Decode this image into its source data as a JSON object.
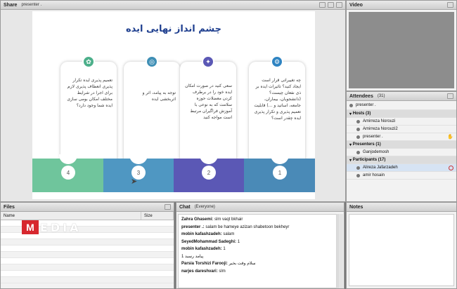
{
  "share": {
    "title": "Share",
    "presenter": "presenter ."
  },
  "slide": {
    "title": "چشم انداز نهایی ایده",
    "cards": [
      {
        "text": "تعمیم پذیری ایده تکرار پذیری انعطاف پذیری لازم برای اجرا در شرایط مختلف امکان بومی سازی ایده شما وجود دارد؟",
        "icon_color": "#4caf8a",
        "icon": "leaf-icon"
      },
      {
        "text": "توجه به پیامد، اثر و اثربخشی ایده",
        "icon_color": "#3f8fb5",
        "icon": "target-icon"
      },
      {
        "text": "سعی کنید در صورت امکان ایده خود را در برطرف کردن معضلات حوزه سلامت که به نوعی با آموزش فراگیران مرتبط است مواجه کنید",
        "icon_color": "#5b58b5",
        "icon": "idea-icon"
      },
      {
        "text": "چه تغییراتی قرار است ایجاد کنید؟ تاثیرات ایده بر ذی نفعان چیست؟ (دانشجویان، بیماران، جامعه، اساتید و ...) قابلیت تعمیم پذیری و تکرار پذیری ایده چقدر است؟",
        "icon_color": "#2f84c2",
        "icon": "gear-icon"
      }
    ],
    "bands": [
      {
        "num": "4",
        "color": "#6fc59c"
      },
      {
        "num": "3",
        "color": "#4f97c2"
      },
      {
        "num": "2",
        "color": "#5b58b5"
      },
      {
        "num": "1",
        "color": "#4a8ab7"
      }
    ]
  },
  "video": {
    "title": "Video"
  },
  "attendees": {
    "title": "Attendees",
    "count": "(31)",
    "me": "presenter .",
    "hosts_label": "Hosts (3)",
    "hosts": [
      "Amirreza Norouzi",
      "Amirreza Norouzi2",
      "presenter ."
    ],
    "presenters_label": "Presenters (1)",
    "presenters": [
      "Ganjodemosh"
    ],
    "participants_label": "Participants (17)",
    "participants": [
      "Alireza Jafarzadeh",
      "amir hosain"
    ]
  },
  "files": {
    "title": "Files",
    "col_name": "Name",
    "col_size": "Size",
    "logo_letter": "M",
    "logo_text": "EDIA"
  },
  "chat": {
    "title": "Chat",
    "scope": "(Everyone)",
    "messages": [
      {
        "name": "Zahra Ghasemi:",
        "text": "slm vaqt bkhair"
      },
      {
        "name": "presenter .:",
        "text": "salam be hameye azizan shabetoon bekheyr"
      },
      {
        "name": "mobin kafashzadeh:",
        "text": "salam"
      },
      {
        "name": "SeyedMohammad Sadeghi:",
        "text": "1"
      },
      {
        "name": "mobin kafashzadeh:",
        "text": "1"
      },
      {
        "name": "",
        "text": "1 پیامد رسید"
      },
      {
        "name": "Parsia Torshizi Farooji:",
        "text": "سلام وقت بخیر"
      },
      {
        "name": "narjes dareshvari:",
        "text": "slm"
      }
    ]
  },
  "notes": {
    "title": "Notes"
  }
}
